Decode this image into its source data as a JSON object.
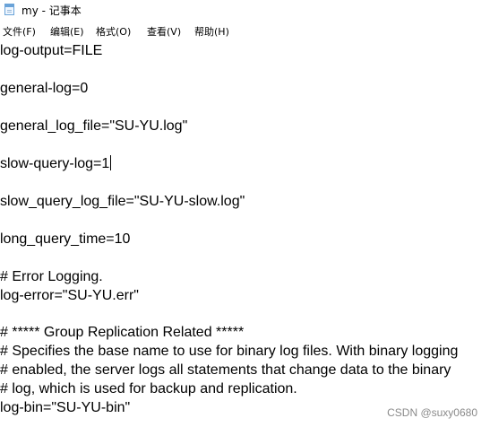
{
  "window": {
    "title": "my - 记事本",
    "icon": "notepad-icon"
  },
  "menu": {
    "file": "文件(F)",
    "edit": "编辑(E)",
    "format": "格式(O)",
    "view": "查看(V)",
    "help": "帮助(H)"
  },
  "editor": {
    "lines": [
      "log-output=FILE",
      "general-log=0",
      "general_log_file=\"SU-YU.log\"",
      "slow-query-log=1",
      "slow_query_log_file=\"SU-YU-slow.log\"",
      "long_query_time=10",
      "# Error Logging.",
      "log-error=\"SU-YU.err\"",
      "# ***** Group Replication Related *****",
      "# Specifies the base name to use for binary log files. With binary logging",
      "# enabled, the server logs all statements that change data to the binary",
      "# log, which is used for backup and replication.",
      "log-bin=\"SU-YU-bin\""
    ]
  },
  "watermark": "CSDN @suxy0680"
}
